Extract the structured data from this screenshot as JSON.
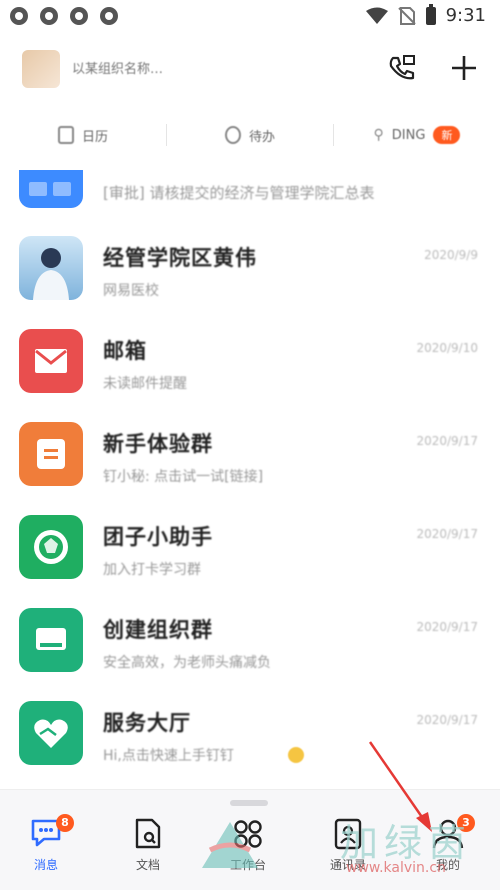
{
  "status_bar": {
    "time": "9:31"
  },
  "header": {
    "org_name": "以某组织名称…"
  },
  "quick_tabs": [
    {
      "label": "日历"
    },
    {
      "label": "待办"
    },
    {
      "label": "DING",
      "badge": "新"
    }
  ],
  "partial_item": {
    "text": "[审批] 请核提交的经济与管理学院汇总表"
  },
  "conversations": [
    {
      "name": "经管学院区黄伟",
      "preview": "网易医校",
      "date": "2020/9/9"
    },
    {
      "name": "邮箱",
      "preview": "未读邮件提醒",
      "date": "2020/9/10"
    },
    {
      "name": "新手体验群",
      "preview": "钉小秘: 点击试一试[链接]",
      "date": "2020/9/17"
    },
    {
      "name": "团子小助手",
      "preview": "加入打卡学习群",
      "date": "2020/9/17"
    },
    {
      "name": "创建组织群",
      "preview": "安全高效，为老师头痛减负",
      "date": "2020/9/17"
    },
    {
      "name": "服务大厅",
      "preview": "Hi,点击快速上手钉钉",
      "date": "2020/9/17"
    }
  ],
  "bottom_nav": [
    {
      "label": "消息",
      "badge": "8",
      "active": true
    },
    {
      "label": "文档",
      "badge": "",
      "active": false
    },
    {
      "label": "工作台",
      "badge": "",
      "active": false
    },
    {
      "label": "通讯录",
      "badge": "",
      "active": false
    },
    {
      "label": "我的",
      "badge": "3",
      "active": false
    }
  ],
  "watermark": {
    "text": "加绿茵",
    "url": "www.kalvin.cn"
  },
  "colors": {
    "accent": "#2f6bff",
    "badge": "#ff5a1f",
    "mail": "#e94e4e",
    "orange": "#f07d3a",
    "green": "#1fae61",
    "teal": "#1fb07a"
  }
}
